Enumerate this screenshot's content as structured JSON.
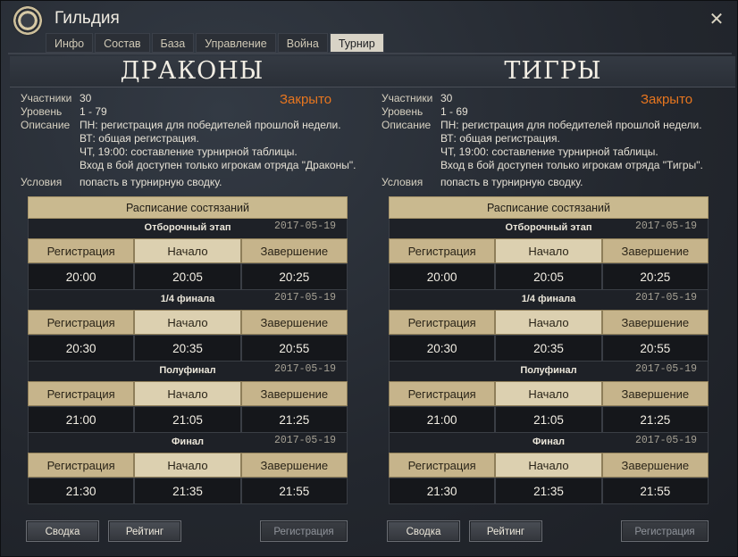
{
  "window": {
    "title": "Гильдия"
  },
  "tabs": [
    "Инфо",
    "Состав",
    "База",
    "Управление",
    "Война",
    "Турнир"
  ],
  "active_tab_index": 5,
  "labels": {
    "participants": "Участники",
    "level": "Уровень",
    "description": "Описание",
    "conditions": "Условия",
    "schedule_title": "Расписание состязаний",
    "col_registration": "Регистрация",
    "col_start": "Начало",
    "col_end": "Завершение",
    "btn_summary": "Сводка",
    "btn_rating": "Рейтинг",
    "btn_register": "Регистрация"
  },
  "colors": {
    "status_closed": "#e8761f",
    "table_header": "#c6b48b",
    "accent_cell": "#dcd0b0"
  },
  "teams": [
    {
      "name": "ДРАКОНЫ",
      "participants": "30",
      "level": "1 - 79",
      "status": "Закрыто",
      "description": [
        "ПН: регистрация для победителей прошлой недели.",
        "ВТ: общая регистрация.",
        "ЧТ, 19:00: составление турнирной таблицы.",
        "Вход в бой доступен только игрокам отряда \"Драконы\"."
      ],
      "conditions": "попасть в турнирную сводку.",
      "stages": [
        {
          "name": "Отборочный этап",
          "date": "2017-05-19",
          "registration": "20:00",
          "start": "20:05",
          "end": "20:25"
        },
        {
          "name": "1/4 финала",
          "date": "2017-05-19",
          "registration": "20:30",
          "start": "20:35",
          "end": "20:55"
        },
        {
          "name": "Полуфинал",
          "date": "2017-05-19",
          "registration": "21:00",
          "start": "21:05",
          "end": "21:25"
        },
        {
          "name": "Финал",
          "date": "2017-05-19",
          "registration": "21:30",
          "start": "21:35",
          "end": "21:55"
        }
      ]
    },
    {
      "name": "ТИГРЫ",
      "participants": "30",
      "level": "1 - 69",
      "status": "Закрыто",
      "description": [
        "ПН: регистрация для победителей прошлой недели.",
        "ВТ: общая регистрация.",
        "ЧТ, 19:00: составление турнирной таблицы.",
        "Вход в бой доступен только игрокам отряда \"Тигры\"."
      ],
      "conditions": "попасть в турнирную сводку.",
      "stages": [
        {
          "name": "Отборочный этап",
          "date": "2017-05-19",
          "registration": "20:00",
          "start": "20:05",
          "end": "20:25"
        },
        {
          "name": "1/4 финала",
          "date": "2017-05-19",
          "registration": "20:30",
          "start": "20:35",
          "end": "20:55"
        },
        {
          "name": "Полуфинал",
          "date": "2017-05-19",
          "registration": "21:00",
          "start": "21:05",
          "end": "21:25"
        },
        {
          "name": "Финал",
          "date": "2017-05-19",
          "registration": "21:30",
          "start": "21:35",
          "end": "21:55"
        }
      ]
    }
  ]
}
